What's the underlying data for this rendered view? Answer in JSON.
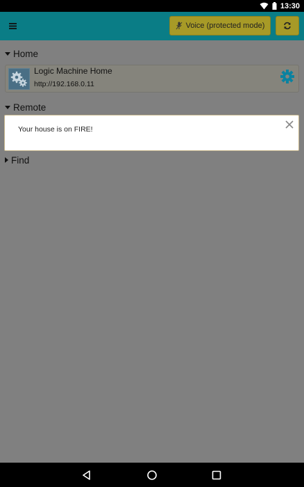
{
  "status_bar": {
    "time": "13:30"
  },
  "toolbar": {
    "voice_label": "Voice (protected mode)"
  },
  "sections": {
    "home": {
      "label": "Home"
    },
    "remote": {
      "label": "Remote"
    },
    "find": {
      "label": "Find"
    }
  },
  "device": {
    "name": "Logic Machine Home",
    "url": "http://192.168.0.11"
  },
  "toast": {
    "message": "Your house is on FIRE!"
  },
  "colors": {
    "app_bar": "#0a7d86",
    "voice_button": "#a79a27",
    "settings_icon": "#0a82a0"
  }
}
